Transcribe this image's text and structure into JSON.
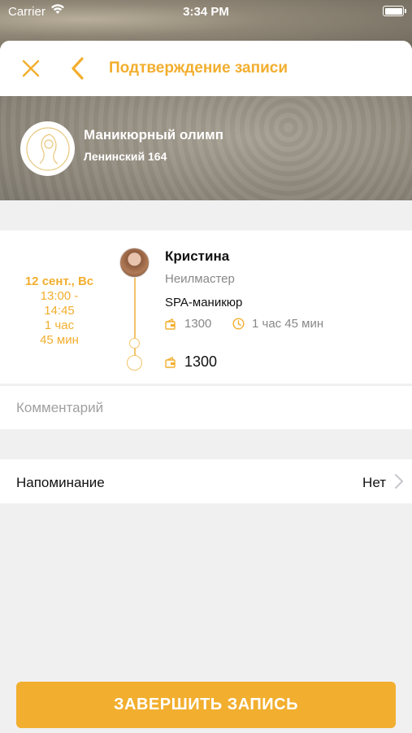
{
  "status_bar": {
    "carrier": "Carrier",
    "time": "3:34 PM"
  },
  "nav": {
    "title": "Подтверждение записи"
  },
  "salon": {
    "name": "Маникюрный олимп",
    "address": "Ленинский 164"
  },
  "booking": {
    "date": "12 сент., Вс",
    "time_range": "13:00 -",
    "time_end": "14:45",
    "duration_hours": "1 час",
    "duration_minutes": "45 мин",
    "master_name": "Кристина",
    "master_role": "Неилмастер",
    "service_name": "SPA-маникюр",
    "service_price": "1300",
    "service_duration": "1 час 45 мин",
    "total_price": "1300"
  },
  "comment": {
    "placeholder": "Комментарий"
  },
  "reminder": {
    "label": "Напоминание",
    "value": "Нет"
  },
  "submit": {
    "label": "ЗАВЕРШИТЬ ЗАПИСЬ"
  },
  "colors": {
    "accent": "#f2ae2e",
    "timeline": "#f2c46a",
    "secondary_text": "#888888"
  }
}
